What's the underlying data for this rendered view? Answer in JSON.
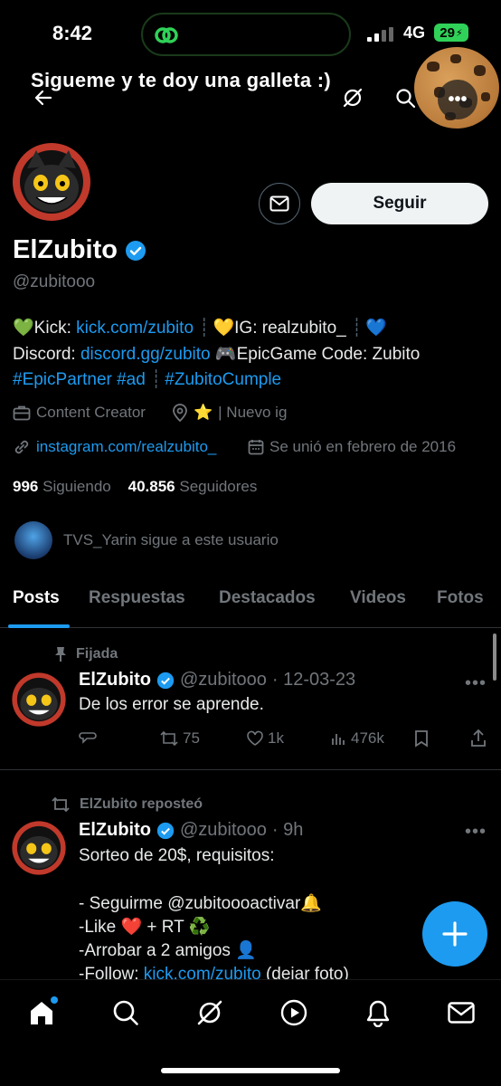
{
  "status_bar": {
    "time": "8:42",
    "network": "4G",
    "battery": "29"
  },
  "header": {
    "banner_text": "Sigueme y te doy una galleta :)"
  },
  "profile": {
    "follow_label": "Seguir",
    "name": "ElZubito",
    "handle": "@zubitooo",
    "bio": {
      "line1_kick_label": "Kick:",
      "line1_kick_link": "kick.com/zubito",
      "line1_ig": "IG: realzubito_",
      "line2_discord_label": "Discord:",
      "line2_discord_link": "discord.gg/zubito",
      "line2_epic": "EpicGame Code: Zubito",
      "line3_tags": "#EpicPartner #ad",
      "line3_tag2": "#ZubitoCumple"
    },
    "category": "Content Creator",
    "location": "| Nuevo ig",
    "website": "instagram.com/realzubito_",
    "joined": "Se unió en febrero de 2016",
    "following_count": "996",
    "following_label": "Siguiendo",
    "followers_count": "40.856",
    "followers_label": "Seguidores",
    "followed_by": "TVS_Yarin sigue a este usuario"
  },
  "tabs": [
    "Posts",
    "Respuestas",
    "Destacados",
    "Videos",
    "Fotos"
  ],
  "posts": [
    {
      "context": "Fijada",
      "author": "ElZubito",
      "handle": "@zubitooo",
      "date": "· 12-03-23",
      "text": "De los error se aprende.",
      "reposts": "75",
      "likes": "1k",
      "views": "476k"
    },
    {
      "context": "ElZubito reposteó",
      "author": "ElZubito",
      "handle": "@zubitooo",
      "date": "· 9h",
      "line1": "Sorteo de 20$, requisitos:",
      "line2": "- Seguirme @zubitoooactivar",
      "line3": "-Like",
      "line3b": "+ RT",
      "line4": "-Arrobar a 2 amigos",
      "line5a": "-Follow:",
      "line5b": "kick.com/zubito",
      "line5c": "(dejar foto)"
    }
  ],
  "icons": [
    "back-arrow-icon",
    "grok-icon",
    "search-icon",
    "more-icon",
    "mail-icon",
    "verified-icon",
    "briefcase-icon",
    "location-icon",
    "link-icon",
    "calendar-icon",
    "pin-icon",
    "repost-icon",
    "reply-icon",
    "heart-icon",
    "views-icon",
    "bookmark-icon",
    "share-icon",
    "home-icon",
    "explore-icon",
    "video-icon",
    "notifications-icon",
    "messages-icon"
  ],
  "colors": {
    "accent": "#1d9bf0",
    "background": "#000000",
    "muted": "#71767b"
  }
}
